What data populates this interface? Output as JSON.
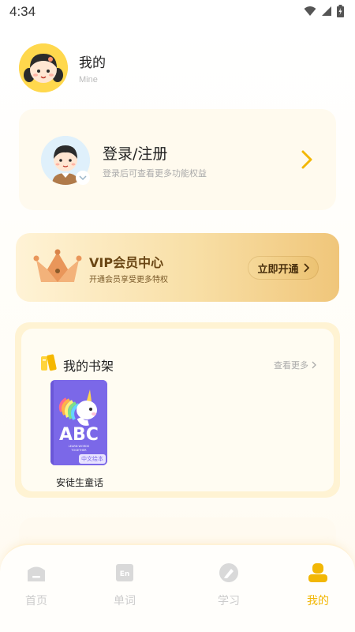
{
  "status_bar": {
    "time": "4:34"
  },
  "profile": {
    "title": "我的",
    "subtitle": "Mine"
  },
  "login_card": {
    "title": "登录/注册",
    "subtitle": "登录后可查看更多功能权益"
  },
  "vip_card": {
    "title": "VIP会员中心",
    "subtitle": "开通会员享受更多特权",
    "button_label": "立即开通"
  },
  "bookshelf": {
    "title": "我的书架",
    "more_label": "查看更多",
    "books": [
      {
        "title": "安徒生童话",
        "cover_text": "ABC",
        "cover_small_text": "LEARN WORDS\nTOGETHER",
        "tag": "中文绘本"
      }
    ]
  },
  "tab_bar": {
    "tabs": [
      {
        "label": "首页",
        "icon": "home-icon",
        "active": false
      },
      {
        "label": "单词",
        "icon": "words-icon",
        "active": false
      },
      {
        "label": "学习",
        "icon": "study-icon",
        "active": false
      },
      {
        "label": "我的",
        "icon": "profile-icon",
        "active": true
      }
    ]
  },
  "colors": {
    "accent": "#f2b705",
    "vip_text": "#6a4614",
    "book_cover": "#7b68e8"
  }
}
